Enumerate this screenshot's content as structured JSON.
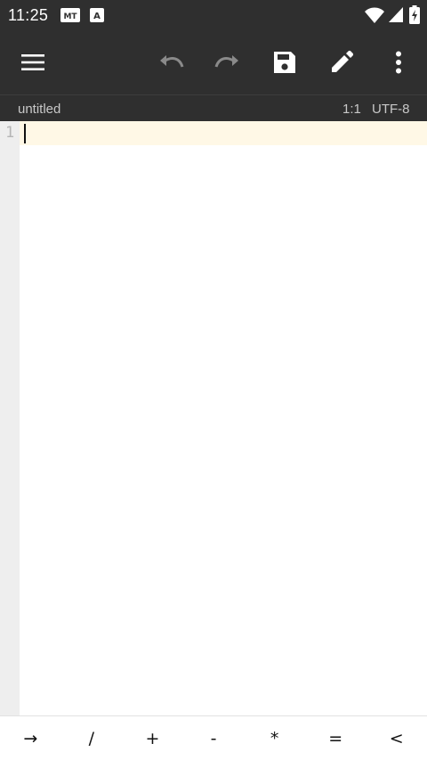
{
  "status_bar": {
    "time": "11:25",
    "notification_icons": [
      "mt-manager-icon",
      "a-letter-icon"
    ],
    "system_icons": [
      "wifi-icon",
      "cellular-signal-icon",
      "battery-charging-icon"
    ]
  },
  "toolbar": {
    "buttons": [
      {
        "name": "menu",
        "icon": "hamburger-menu-icon",
        "enabled": true
      },
      {
        "name": "undo",
        "icon": "undo-icon",
        "enabled": false
      },
      {
        "name": "redo",
        "icon": "redo-icon",
        "enabled": false
      },
      {
        "name": "save",
        "icon": "save-icon",
        "enabled": true
      },
      {
        "name": "edit",
        "icon": "pencil-icon",
        "enabled": true
      },
      {
        "name": "more",
        "icon": "more-vertical-icon",
        "enabled": true
      }
    ]
  },
  "subheader": {
    "filename": "untitled",
    "cursor_position": "1:1",
    "encoding": "UTF-8"
  },
  "editor": {
    "line_numbers": [
      "1"
    ],
    "content": ""
  },
  "symbol_bar": {
    "keys": [
      "→",
      "/",
      "+",
      "-",
      "*",
      "=",
      "<"
    ]
  },
  "colors": {
    "toolbar_background": "#2f2f2f",
    "gutter_background": "#eeeeee",
    "current_line_highlight": "#fff8e6",
    "disabled_icon": "#8a8a8a",
    "enabled_icon": "#ffffff"
  }
}
